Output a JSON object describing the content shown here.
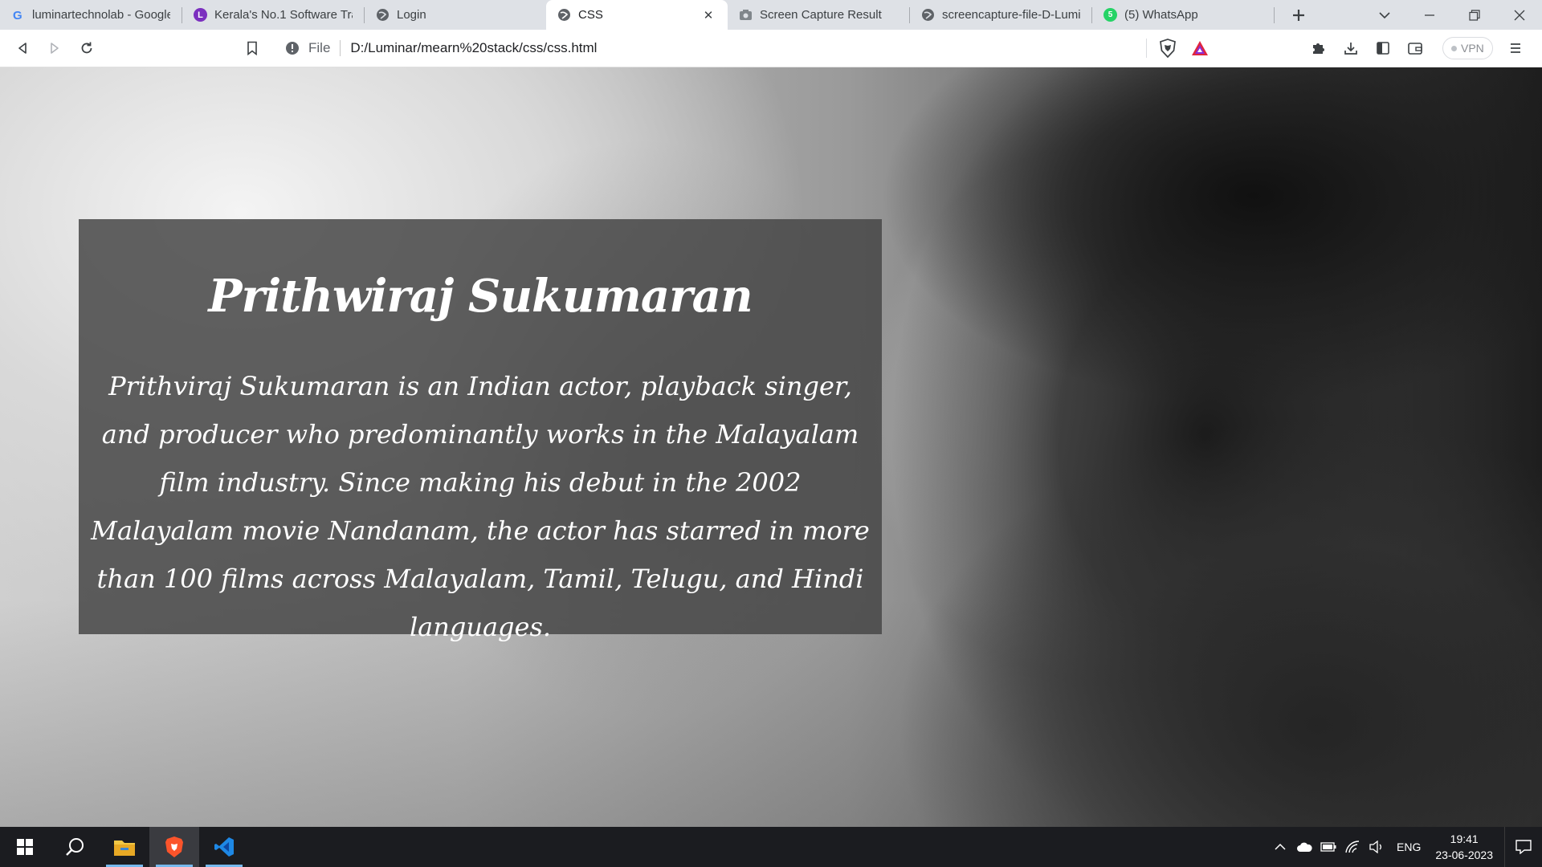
{
  "browser": {
    "tabs": [
      {
        "label": "luminartechnolab - Google",
        "icon": "google-icon"
      },
      {
        "label": "Kerala's No.1 Software Trai",
        "icon": "luminar-logo-icon"
      },
      {
        "label": "Login",
        "icon": "globe-icon"
      },
      {
        "label": "CSS",
        "icon": "globe-icon",
        "active": true
      },
      {
        "label": "Screen Capture Result",
        "icon": "camera-icon"
      },
      {
        "label": "screencapture-file-D-Lumir",
        "icon": "globe-icon"
      },
      {
        "label": "(5) WhatsApp",
        "icon": "whatsapp-icon"
      }
    ],
    "omnibox": {
      "scheme_label": "File",
      "url": "D:/Luminar/mearn%20stack/css/css.html"
    },
    "vpn_label": "VPN"
  },
  "page": {
    "title": "Prithwiraj Sukumaran",
    "text": "Prithviraj Sukumaran is an Indian actor, playback singer, and producer who predominantly works in the Malayalam film industry. Since making his debut in the 2002 Malayalam movie Nandanam, the actor has starred in more than 100 films across Malayalam, Tamil, Telugu, and Hindi languages."
  },
  "taskbar": {
    "apps": [
      "windows-start-icon",
      "search-icon",
      "file-explorer-icon",
      "brave-browser-icon",
      "vscode-icon"
    ],
    "language": "ENG",
    "time": "19:41",
    "date": "23-06-2023"
  },
  "colors": {
    "tabstrip_bg": "#dee1e6",
    "toolbar_bg": "#ffffff",
    "card_bg": "rgba(70,70,70,0.85)",
    "taskbar_bg": "#1b1c20",
    "brave_orange": "#fb542b"
  }
}
